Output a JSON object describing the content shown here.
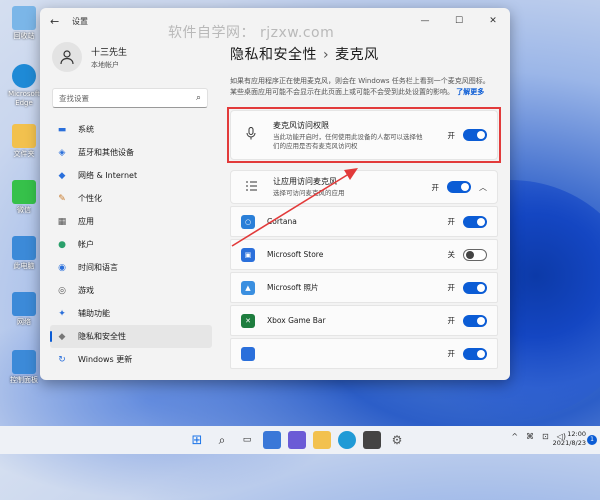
{
  "watermark": "软件自学网： rjzxw.com",
  "desktop": [
    {
      "label": "回收站",
      "color": "#7bb6e8"
    },
    {
      "label": "Microsoft Edge",
      "color": "#1f8ad6"
    },
    {
      "label": "文件夹",
      "color": "#f2c14e"
    },
    {
      "label": "微信",
      "color": "#36c14a"
    },
    {
      "label": "此电脑",
      "color": "#3c8ad8"
    },
    {
      "label": "网络",
      "color": "#3c8ad8"
    },
    {
      "label": "控制面板",
      "color": "#3c8ad8"
    }
  ],
  "window": {
    "app_title": "设置",
    "back": "←",
    "minimize": "—",
    "maximize": "☐",
    "close": "✕"
  },
  "user": {
    "name": "十三先生",
    "account": "本地帐户"
  },
  "search": {
    "placeholder": "查找设置",
    "icon": "search-icon"
  },
  "nav": [
    {
      "label": "系统",
      "icon": "▬",
      "color": "#2a6fdb"
    },
    {
      "label": "蓝牙和其他设备",
      "icon": "◈",
      "color": "#2a6fdb"
    },
    {
      "label": "网络 & Internet",
      "icon": "◆",
      "color": "#2a6fdb"
    },
    {
      "label": "个性化",
      "icon": "✎",
      "color": "#c87a2a"
    },
    {
      "label": "应用",
      "icon": "▦",
      "color": "#555"
    },
    {
      "label": "帐户",
      "icon": "●",
      "color": "#2aa06b"
    },
    {
      "label": "时间和语言",
      "icon": "◉",
      "color": "#2a6fdb"
    },
    {
      "label": "游戏",
      "icon": "◎",
      "color": "#555"
    },
    {
      "label": "辅助功能",
      "icon": "✦",
      "color": "#2a6fdb"
    },
    {
      "label": "隐私和安全性",
      "icon": "◆",
      "color": "#777",
      "active": true
    },
    {
      "label": "Windows 更新",
      "icon": "↻",
      "color": "#2a6fdb"
    }
  ],
  "breadcrumb": {
    "parent": "隐私和安全性",
    "separator": "›",
    "current": "麦克风"
  },
  "description": {
    "text": "如果有应用程序正在使用麦克风，则会在 Windows 任务栏上看到一个麦克风图标。某些桌面应用可能不会显示在此页面上或可能不会受到此处设置的影响。",
    "link": "了解更多"
  },
  "mic_access": {
    "title": "麦克风访问权限",
    "desc": "当此功能开启时，任何使用此设备的人都可以选择他们的应用是否有麦克风访问权",
    "state": "开",
    "on": true
  },
  "app_access": {
    "title": "让应用访问麦克风",
    "desc": "选择可访问麦克风的应用",
    "state": "开",
    "on": true
  },
  "apps": [
    {
      "name": "Cortana",
      "state": "开",
      "on": true,
      "color": "#2a7fd8"
    },
    {
      "name": "Microsoft Store",
      "state": "关",
      "on": false,
      "color": "#2a6fdb"
    },
    {
      "name": "Microsoft 照片",
      "state": "开",
      "on": true,
      "color": "#3a8fe0"
    },
    {
      "name": "Xbox Game Bar",
      "state": "开",
      "on": true,
      "color": "#1e7d3e"
    },
    {
      "name": "",
      "state": "开",
      "on": true,
      "color": "#2a6fdb"
    }
  ],
  "taskbar": {
    "icons": [
      "windows-icon",
      "search-icon",
      "task-view-icon",
      "widgets-icon",
      "chat-icon",
      "explorer-icon",
      "edge-icon",
      "store-icon",
      "settings-icon"
    ],
    "tray": [
      "^",
      "⌘",
      "⊡",
      "◁)"
    ],
    "time": "12:00",
    "date": "2021/8/23",
    "notifications": "1"
  }
}
